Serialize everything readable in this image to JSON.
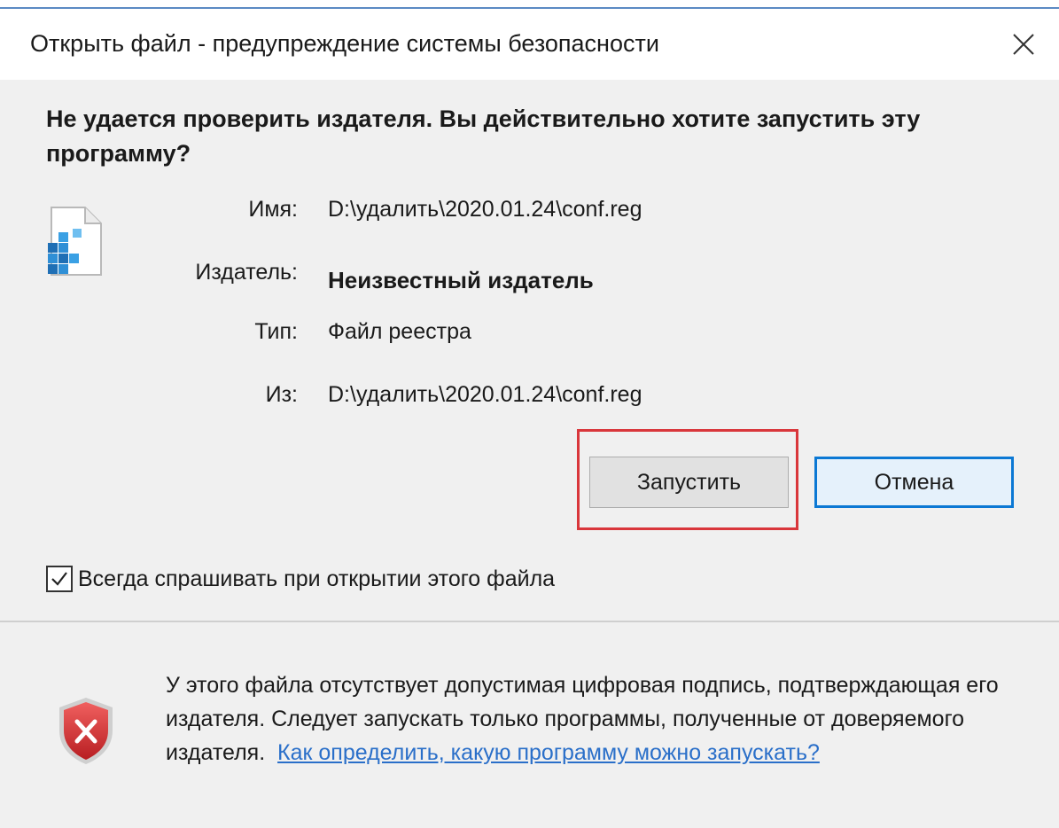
{
  "window": {
    "title": "Открыть файл - предупреждение системы безопасности",
    "close_icon": "close-icon"
  },
  "dialog": {
    "heading": "Не удается проверить издателя.  Вы действительно хотите запустить эту программу?",
    "file_icon": "registry-file-icon",
    "fields": {
      "name_label": "Имя:",
      "name_value": "D:\\удалить\\2020.01.24\\conf.reg",
      "publisher_label": "Издатель:",
      "publisher_value": "Неизвестный издатель",
      "type_label": "Тип:",
      "type_value": "Файл реестра",
      "from_label": "Из:",
      "from_value": "D:\\удалить\\2020.01.24\\conf.reg"
    },
    "buttons": {
      "run_label": "Запустить",
      "cancel_label": "Отмена"
    },
    "checkbox": {
      "label": "Всегда спрашивать при открытии этого файла",
      "checked": true
    }
  },
  "footer": {
    "shield_icon": "shield-error-icon",
    "warning_text": "У этого файла отсутствует допустимая цифровая подпись, подтверждающая его издателя.  Следует запускать только программы, полученные от доверяемого издателя.",
    "link_text": "Как определить, какую программу можно запускать?"
  },
  "colors": {
    "accent": "#0b78d4",
    "highlight": "#d9363b",
    "link": "#2a6fc9",
    "dialog_bg": "#f0f0f0"
  }
}
